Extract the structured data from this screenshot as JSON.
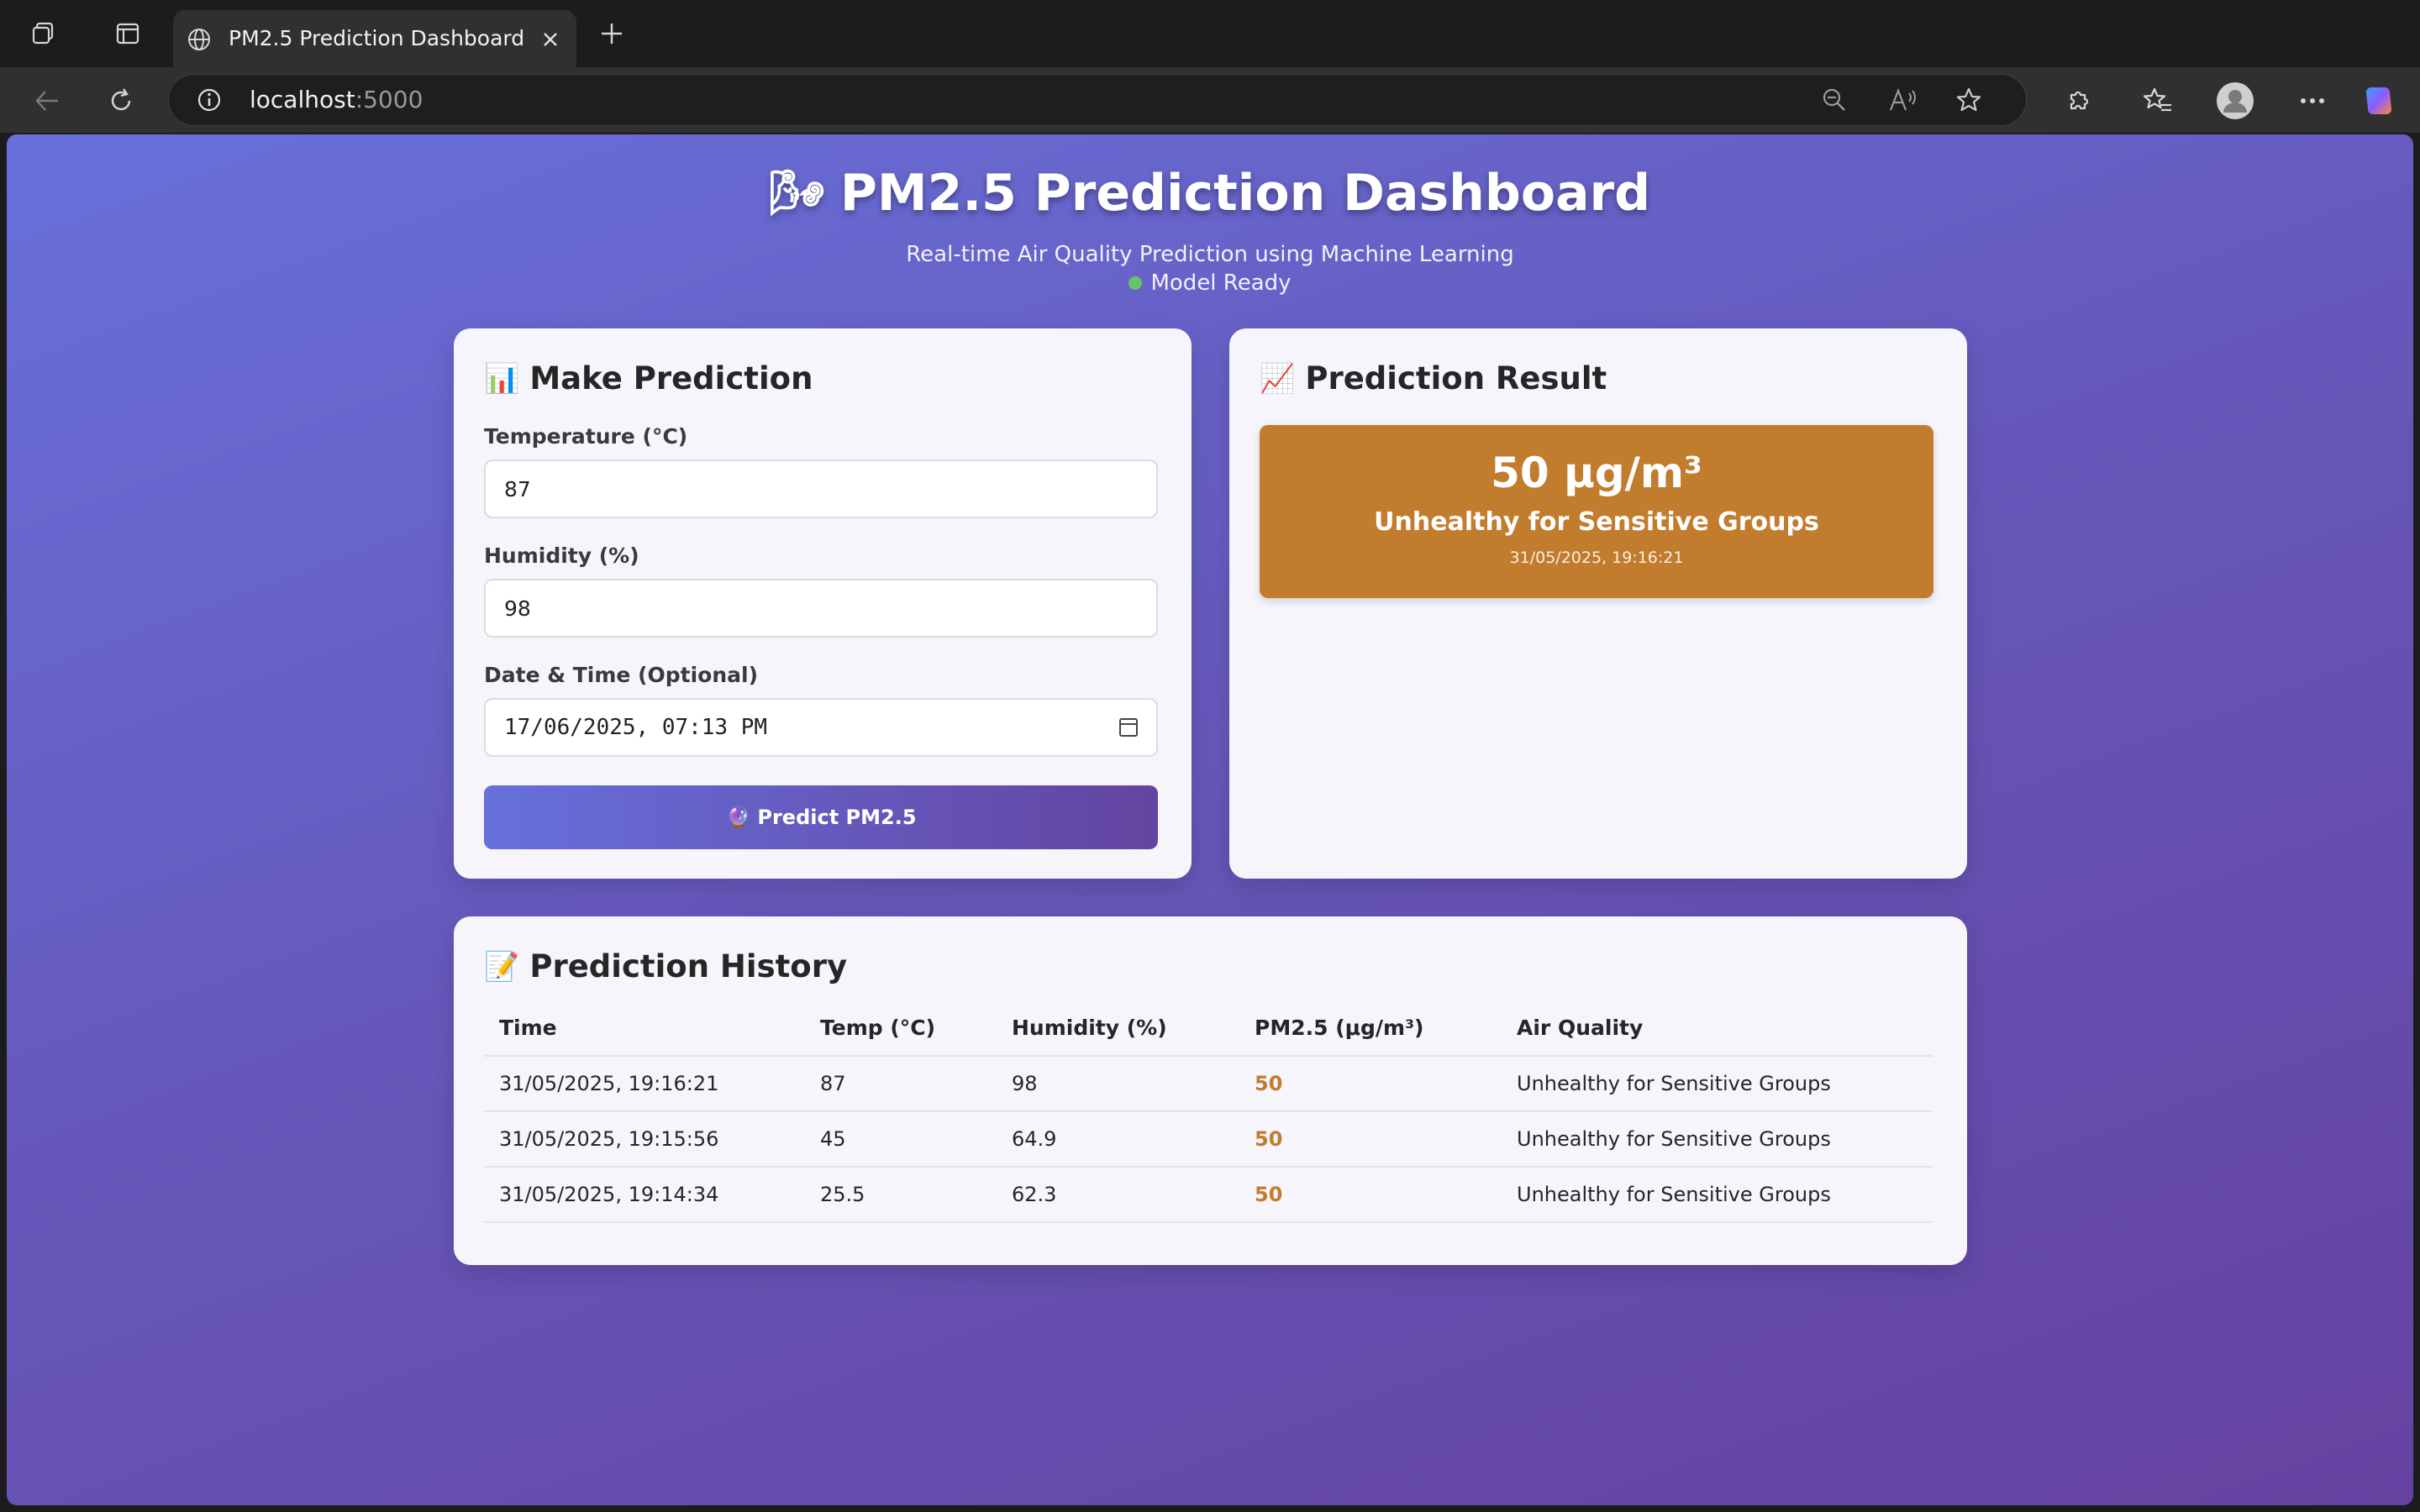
{
  "browser": {
    "tab_title": "PM2.5 Prediction Dashboard",
    "url_host": "localhost",
    "url_port": ":5000"
  },
  "header": {
    "icon": "🌬",
    "title": "PM2.5 Prediction Dashboard",
    "subtitle": "Real-time Air Quality Prediction using Machine Learning",
    "status": "Model Ready",
    "status_color": "#63c46c"
  },
  "prediction_form": {
    "icon": "📊",
    "title": "Make Prediction",
    "temperature_label": "Temperature (°C)",
    "temperature_value": "87",
    "humidity_label": "Humidity (%)",
    "humidity_value": "98",
    "datetime_label": "Date & Time (Optional)",
    "datetime_value": "17/06/2025, 07:13 PM",
    "button_icon": "🔮",
    "button_label": "Predict PM2.5"
  },
  "result": {
    "icon": "📈",
    "title": "Prediction Result",
    "value": "50 μg/m³",
    "category": "Unhealthy for Sensitive Groups",
    "timestamp": "31/05/2025, 19:16:21",
    "color": "#c27c2e"
  },
  "history": {
    "icon": "📝",
    "title": "Prediction History",
    "columns": [
      "Time",
      "Temp (°C)",
      "Humidity (%)",
      "PM2.5 (μg/m³)",
      "Air Quality"
    ],
    "rows": [
      [
        "31/05/2025, 19:16:21",
        "87",
        "98",
        "50",
        "Unhealthy for Sensitive Groups"
      ],
      [
        "31/05/2025, 19:15:56",
        "45",
        "64.9",
        "50",
        "Unhealthy for Sensitive Groups"
      ],
      [
        "31/05/2025, 19:14:34",
        "25.5",
        "62.3",
        "50",
        "Unhealthy for Sensitive Groups"
      ]
    ]
  }
}
